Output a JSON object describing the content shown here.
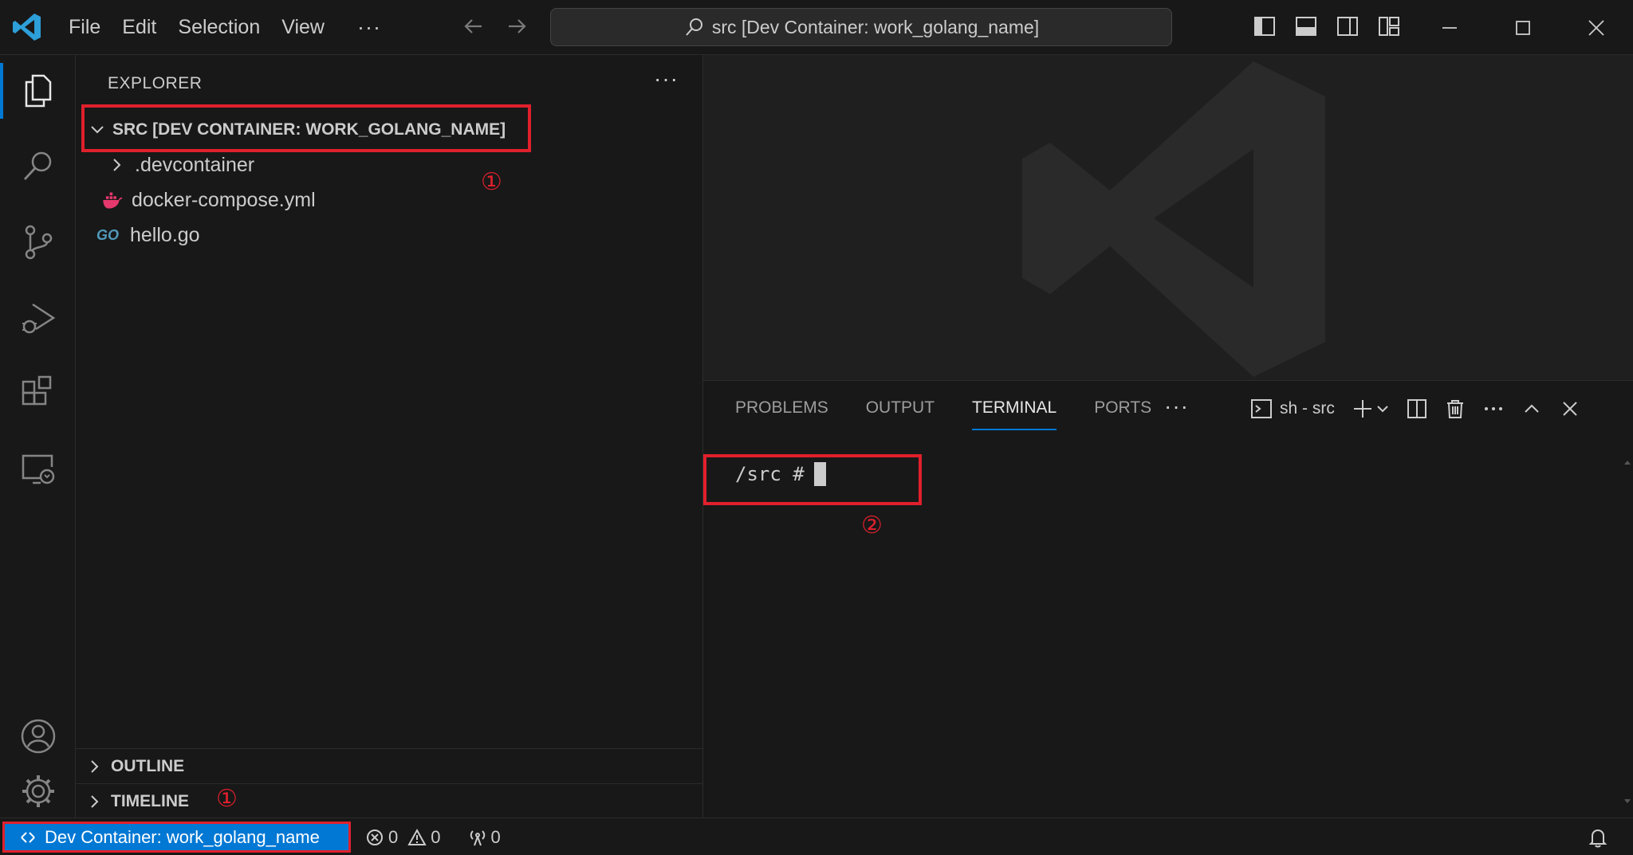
{
  "titlebar": {
    "menu": [
      "File",
      "Edit",
      "Selection",
      "View"
    ],
    "more": "···",
    "command_center": "src [Dev Container: work_golang_name]"
  },
  "sidebar": {
    "title": "EXPLORER",
    "more": "···",
    "folder": "SRC [DEV CONTAINER: WORK_GOLANG_NAME]",
    "items": [
      {
        "label": ".devcontainer",
        "type": "folder"
      },
      {
        "label": "docker-compose.yml",
        "type": "docker"
      },
      {
        "label": "hello.go",
        "type": "go",
        "icon_text": "GO"
      }
    ],
    "sections": [
      "OUTLINE",
      "TIMELINE"
    ]
  },
  "annotations": {
    "marker_1": "①",
    "marker_2": "②"
  },
  "panel": {
    "tabs": [
      "PROBLEMS",
      "OUTPUT",
      "TERMINAL",
      "PORTS"
    ],
    "active_tab": "TERMINAL",
    "more": "···",
    "terminal_name": "sh - src",
    "prompt": "/src #"
  },
  "statusbar": {
    "remote": "Dev Container: work_golang_name",
    "errors": "0",
    "warnings": "0",
    "ports": "0"
  },
  "colors": {
    "accent": "#0078d4",
    "highlight": "#e0202c",
    "background": "#181818"
  }
}
